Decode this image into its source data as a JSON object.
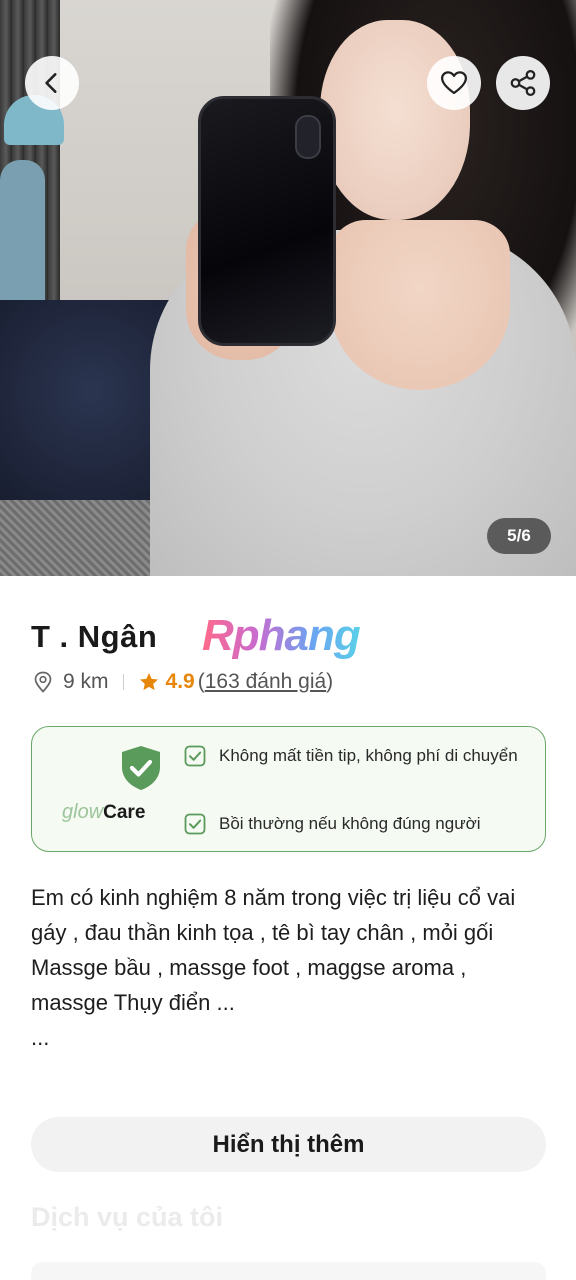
{
  "gallery": {
    "counter": "5/6"
  },
  "profile": {
    "name": "T . Ngân",
    "brand": "Rphang",
    "distance": "9 km",
    "rating": "4.9",
    "reviews_open": "(",
    "reviews": "163 đánh giá",
    "reviews_close": ")"
  },
  "care": {
    "brand_glow": "glow",
    "brand_care": "Care",
    "items": [
      "Không mất tiền tip, không phí di chuyển",
      "Bồi thường nếu không đúng người"
    ],
    "colors": {
      "accent": "#5a9a5a",
      "border": "#6aa86a"
    }
  },
  "description": {
    "lines": [
      "Em có kinh nghiệm 8 năm trong việc trị liệu cổ vai gáy , đau thần kinh tọa , tê bì tay chân , mỏi gối",
      "Massge bầu , massge foot , maggse aroma , massge Thụy điển ...",
      "..."
    ]
  },
  "actions": {
    "show_more": "Hiển thị thêm"
  },
  "sections": {
    "services_title": "Dịch vụ của tôi"
  },
  "icons": {
    "back": "chevron-left-icon",
    "favorite": "heart-icon",
    "share": "share-icon",
    "location": "map-pin-icon",
    "rating": "star-icon",
    "care_shield": "shield-check-icon",
    "check": "checkbox-icon"
  }
}
